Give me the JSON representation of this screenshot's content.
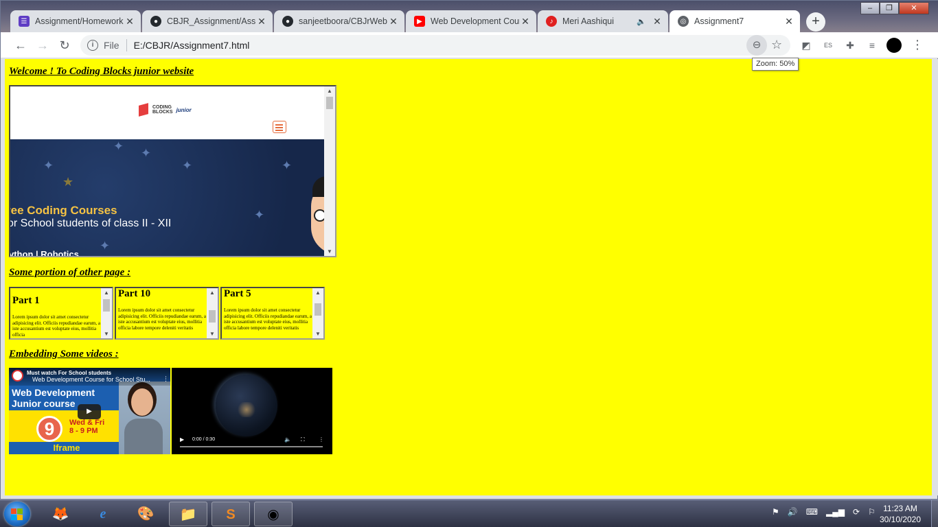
{
  "browser": {
    "tabs": [
      {
        "title": "Assignment/Homework",
        "icon": "list-icon",
        "color": "#5f3dc4"
      },
      {
        "title": "CBJR_Assignment/Assig",
        "icon": "github-icon",
        "color": "#24292e"
      },
      {
        "title": "sanjeetboora/CBJrWeb",
        "icon": "github-icon",
        "color": "#24292e"
      },
      {
        "title": "Web Development Cour",
        "icon": "youtube-icon",
        "color": "#ff0000"
      },
      {
        "title": "Meri Aashiqui",
        "icon": "music-icon",
        "color": "#e02020"
      },
      {
        "title": "Assignment7",
        "icon": "globe-icon",
        "color": "#5f6368"
      }
    ],
    "address": {
      "scheme_label": "File",
      "url": "E:/CBJR/Assignment7.html"
    },
    "zoom_tooltip": "Zoom: 50%"
  },
  "page": {
    "welcome_heading": "Welcome ! To Coding Blocks junior website",
    "iframe_site": {
      "logo_line1": "CODING",
      "logo_line2": "BLOCKS",
      "logo_junior": "junior",
      "banner_line1": "ree Coding Courses",
      "banner_line2": "or School students of class II - XII",
      "banner_line3": "ython | Robotics"
    },
    "portion_heading": "Some portion of other page :",
    "parts": [
      {
        "title": "Part 1",
        "text": "Lorem ipsum dolor sit amet consectetur adipisicing elit. Officiis repudiandae earum, a iste accusantium est voluptate eius, mollitia officia"
      },
      {
        "title": "Part 10",
        "text": "Lorem ipsum dolor sit amet consectetur adipisicing elit. Officiis repudiandae earum, a iste accusantium est voluptate eius, mollitia officia labore tempore deleniti veritatis"
      },
      {
        "title": "Part 5",
        "text": "Lorem ipsum dolor sit amet consectetur adipisicing elit. Officiis repudiandae earum, a iste accusantium est voluptate eius, mollitia officia labore tempore deleniti veritatis"
      }
    ],
    "videos_heading": "Embedding Some videos :",
    "youtube": {
      "channel_badge": "Must watch For School students",
      "title": "Web Development Course for School Stu...",
      "thumb_line1": "Web Development",
      "thumb_line2": "Junior course",
      "thumb_number": "9",
      "thumb_days": "Wed & Fri",
      "thumb_time": "8 - 9 PM",
      "thumb_label": "Iframe"
    },
    "video": {
      "time": "0:00 / 0:30"
    }
  },
  "taskbar": {
    "clock_time": "11:23 AM",
    "clock_date": "30/10/2020"
  }
}
